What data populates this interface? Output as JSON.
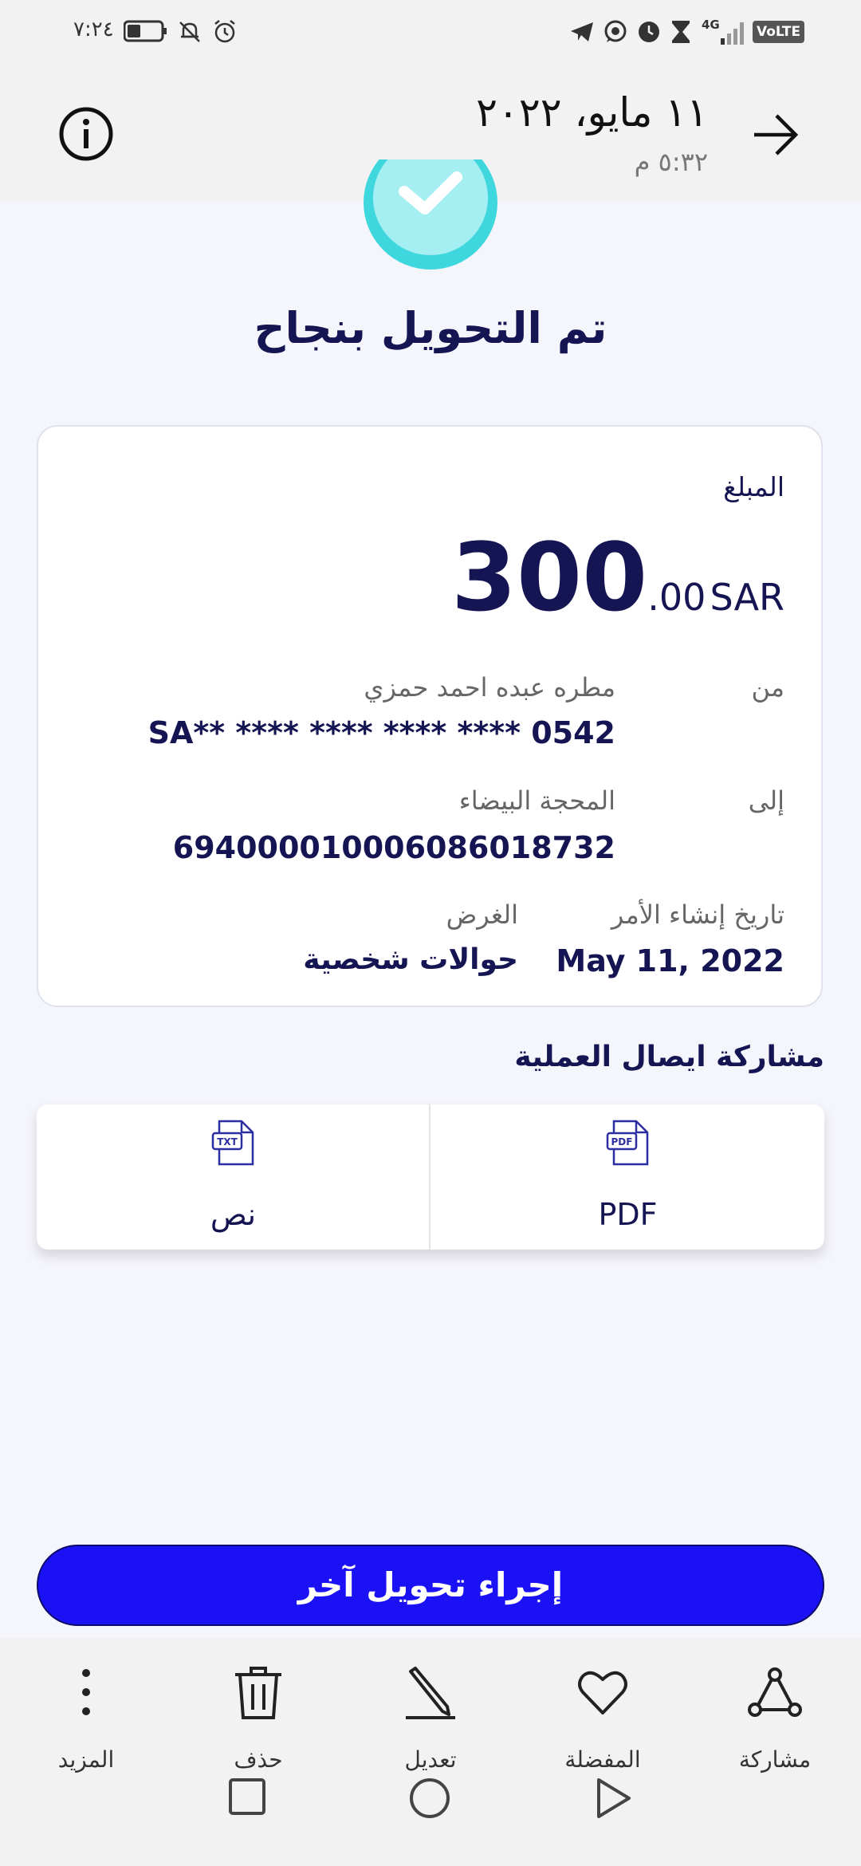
{
  "status_bar": {
    "time": "٧:٢٤",
    "network": "4G",
    "volte": "VoLTE"
  },
  "header": {
    "date": "١١ مايو، ٢٠٢٢",
    "time": "٥:٣٢ م"
  },
  "success": {
    "title": "تم التحويل بنجاح"
  },
  "card": {
    "amount_label": "المبلغ",
    "amount_integer": "300",
    "amount_decimal": ".00",
    "currency": "SAR",
    "from_label": "من",
    "from_name": "مطره عبده احمد حمزي",
    "from_account": "SA** **** **** **** **** 0542",
    "to_label": "إلى",
    "to_name": "المحجة البيضاء",
    "to_account": "694000010006086018732",
    "date_label": "تاريخ إنشاء الأمر",
    "date_value": "May 11, 2022",
    "purpose_label": "الغرض",
    "purpose_value": "حوالات شخصية"
  },
  "share": {
    "title": "مشاركة ايصال العملية",
    "pdf_label": "PDF",
    "pdf_icon_text": "PDF",
    "text_label": "نص",
    "text_icon_text": "TXT"
  },
  "another_transfer_label": "إجراء تحويل آخر",
  "toolbar": {
    "share": "مشاركة",
    "favorite": "المفضلة",
    "edit": "تعديل",
    "delete": "حذف",
    "more": "المزيد"
  },
  "colors": {
    "primary_button": "#1a12f5",
    "navy_text": "#141552",
    "success_teal": "#3ed7de",
    "background": "#f5f6fc"
  }
}
